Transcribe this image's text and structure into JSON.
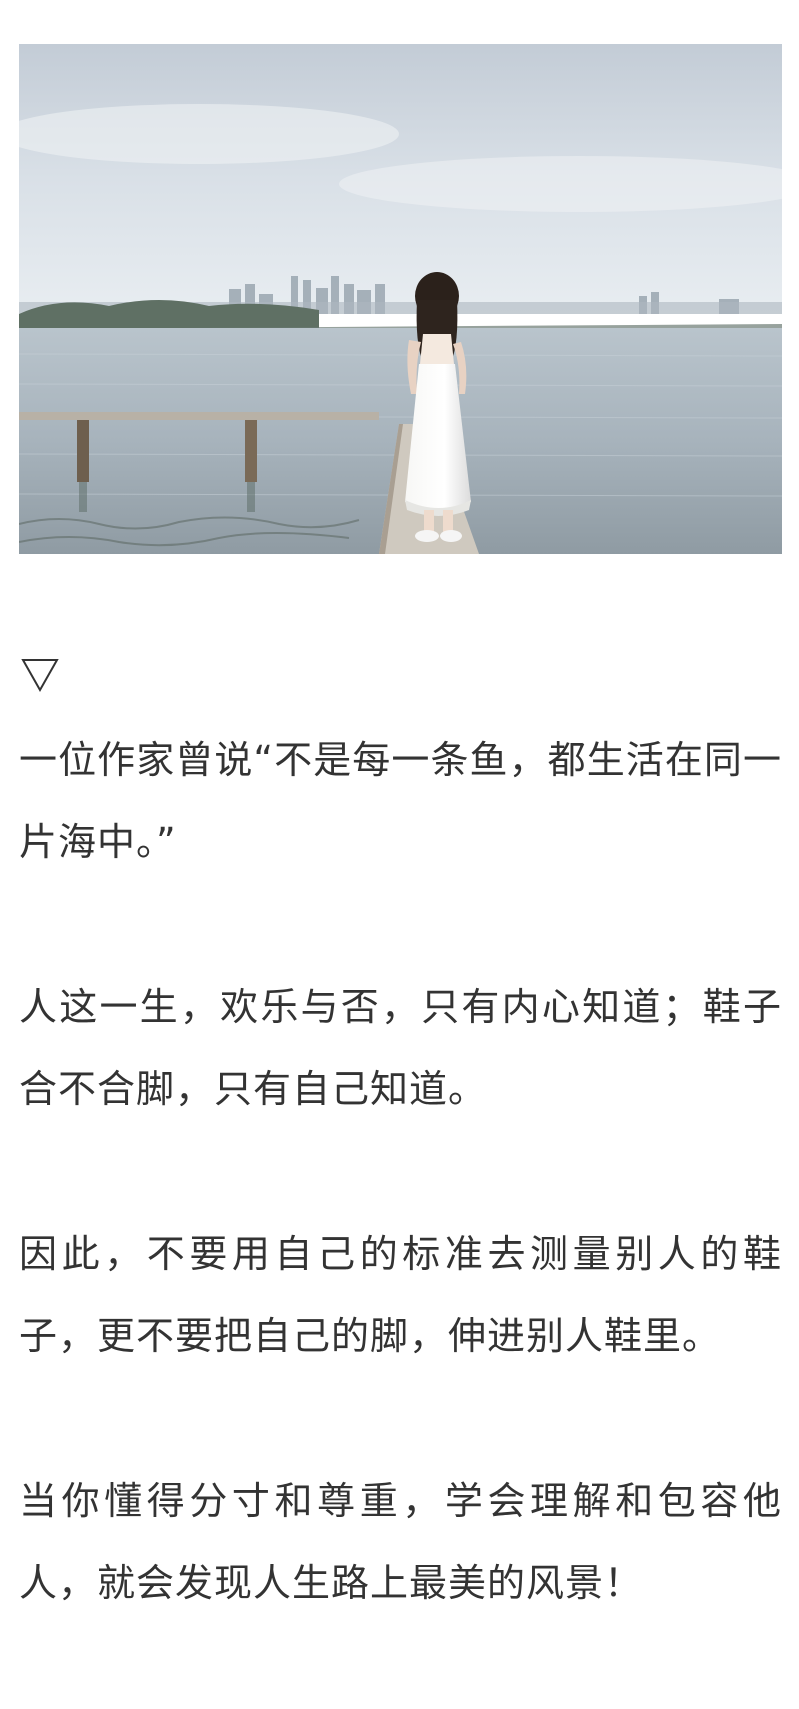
{
  "article": {
    "image": {
      "description": "woman-in-white-dress-on-pier-by-lake"
    },
    "marker": {
      "icon": "down-triangle-outline-icon",
      "glyph": "▽"
    },
    "paragraphs": [
      "一位作家曾说“不是每一条鱼，都生活在同一片海中。”",
      "人这一生，欢乐与否，只有内心知道；鞋子合不合脚，只有自己知道。",
      "因此，不要用自己的标准去测量别人的鞋子，更不要把自己的脚，伸进别人鞋里。",
      "当你懂得分寸和尊重，学会理解和包容他人，就会发现人生路上最美的风景！"
    ]
  },
  "colors": {
    "text": "#333333",
    "background": "#ffffff",
    "sky_top": "#c9d2dc",
    "sky_bottom": "#e6ecf1",
    "water": "#a9b5bf"
  }
}
